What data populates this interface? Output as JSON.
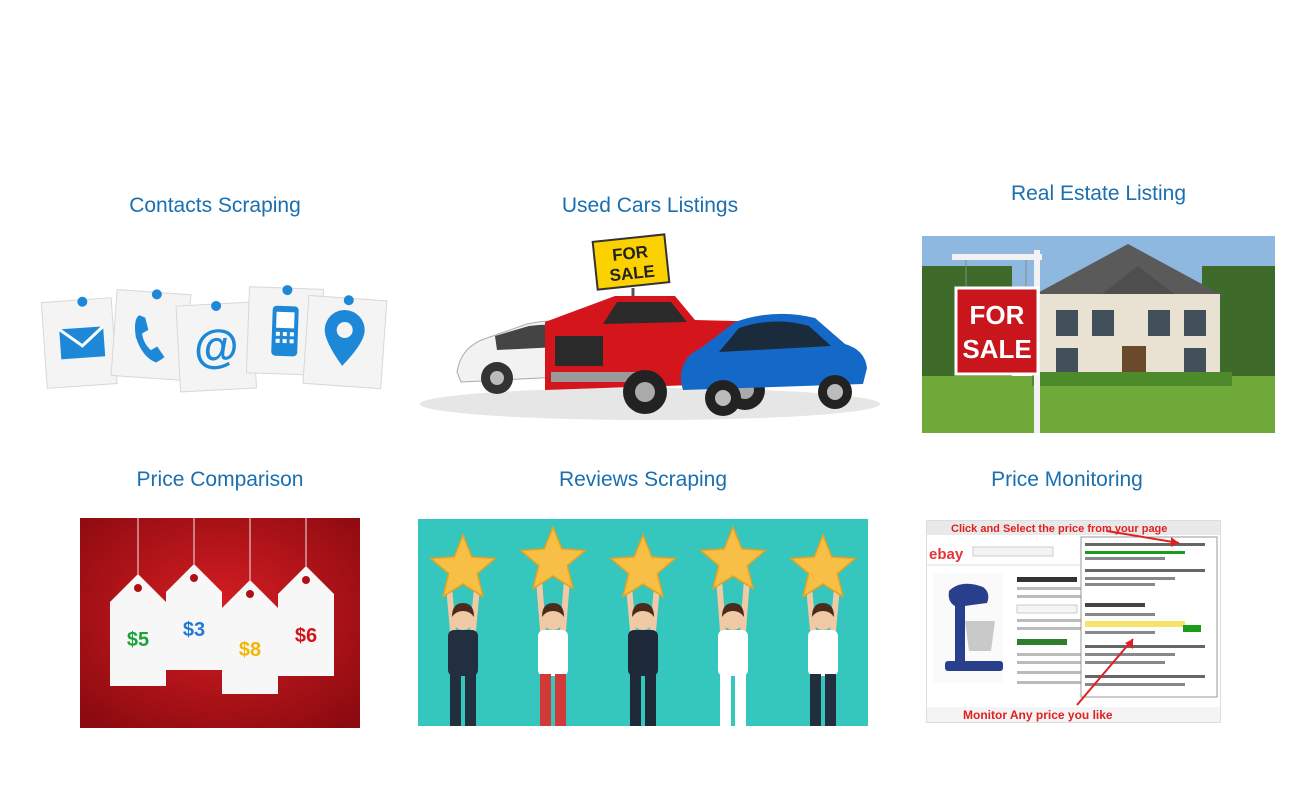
{
  "cards": [
    {
      "title": "Contacts Scraping",
      "icons": [
        "email-icon",
        "phone-icon",
        "at-sign-icon",
        "mobile-phone-icon",
        "location-pin-icon"
      ]
    },
    {
      "title": "Used Cars Listings",
      "sign_text": [
        "FOR",
        "SALE"
      ]
    },
    {
      "title": "Real Estate Listing",
      "sign_text": [
        "FOR",
        "SALE"
      ]
    },
    {
      "title": "Price Comparison",
      "tags": [
        "$5",
        "$3",
        "$8",
        "$6"
      ]
    },
    {
      "title": "Reviews Scraping",
      "stars": 5
    },
    {
      "title": "Price Monitoring",
      "top_note": "Click and Select the price from your page",
      "bottom_note": "Monitor Any price you like",
      "store_logo": "ebay"
    }
  ],
  "colors": {
    "title": "#1a6fb0",
    "note_red": "#e02020",
    "reviews_bg": "#35c6bd",
    "price_bg": "#b00d14",
    "star": "#f7bf45"
  }
}
